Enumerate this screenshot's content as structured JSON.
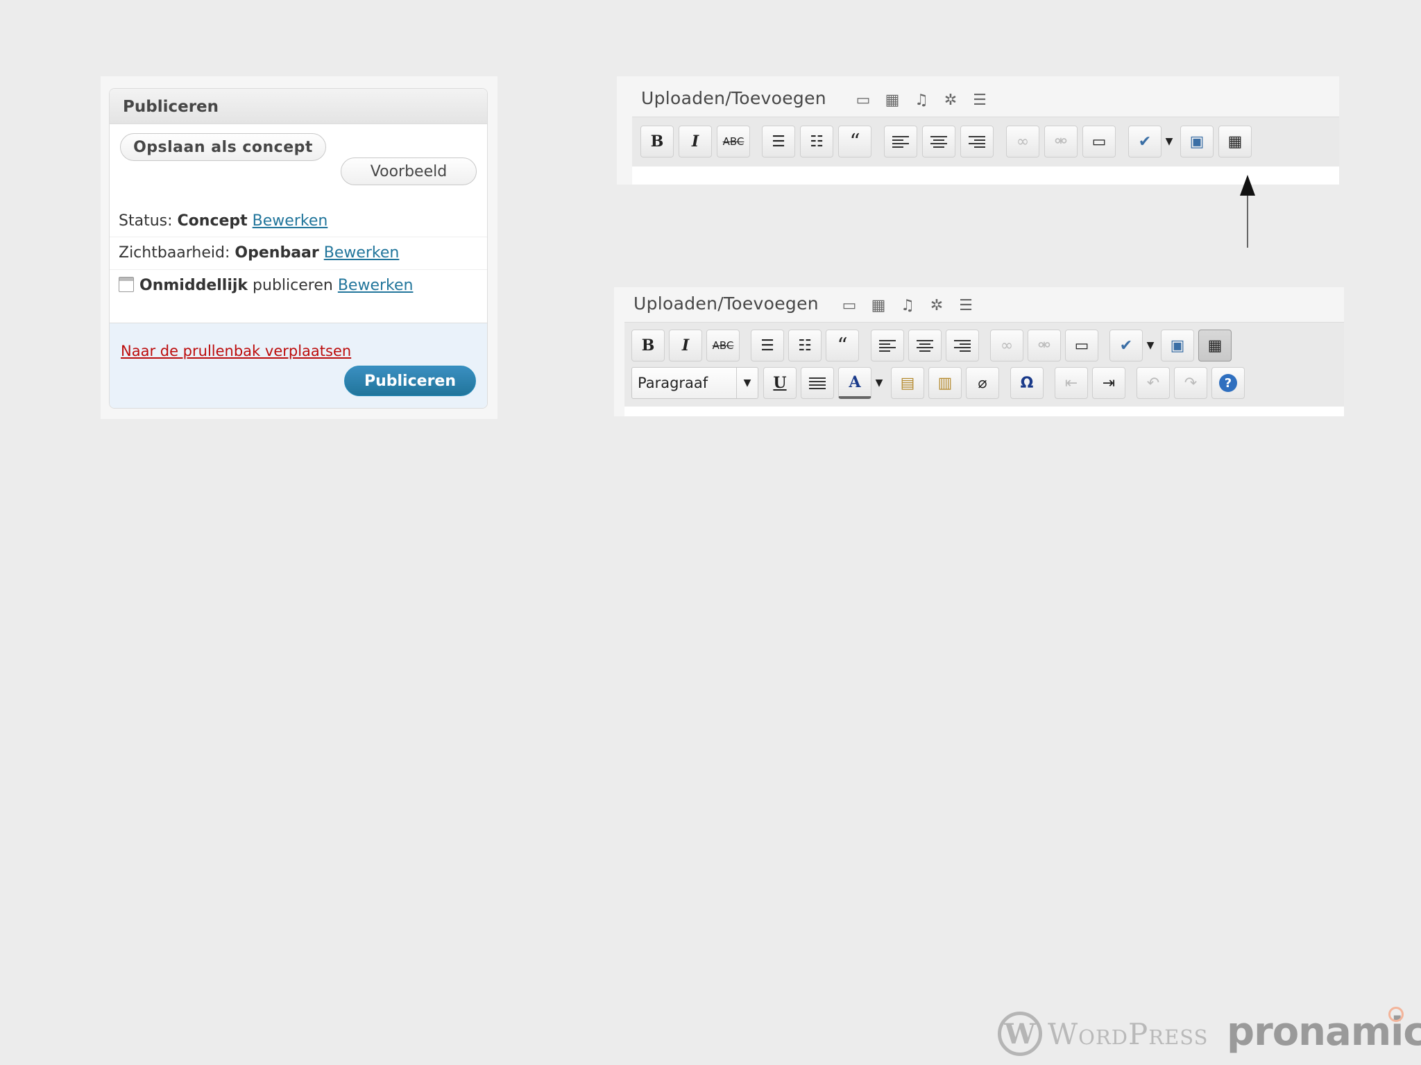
{
  "publish": {
    "title": "Publiceren",
    "save_draft_label": "Opslaan als concept",
    "preview_label": "Voorbeeld",
    "status_label": "Status:",
    "status_value": "Concept",
    "visibility_label": "Zichtbaarheid:",
    "visibility_value": "Openbaar",
    "schedule_value": "Onmiddellijk",
    "schedule_suffix": "publiceren",
    "edit_link": "Bewerken",
    "trash_label": "Naar de prullenbak verplaatsen",
    "publish_label": "Publiceren"
  },
  "editor_top": {
    "upload_label": "Uploaden/Toevoegen",
    "media_icons": [
      "image-icon",
      "gallery-icon",
      "audio-icon",
      "media-icon",
      "menu-icon"
    ],
    "row1": [
      {
        "name": "bold-button",
        "glyph": "B"
      },
      {
        "name": "italic-button",
        "glyph": "I"
      },
      {
        "name": "strikethrough-button",
        "glyph": "ABC"
      },
      {
        "name": "bullet-list-button",
        "glyph": "ul"
      },
      {
        "name": "numbered-list-button",
        "glyph": "ol"
      },
      {
        "name": "blockquote-button",
        "glyph": "“"
      },
      {
        "name": "align-left-button",
        "glyph": "al"
      },
      {
        "name": "align-center-button",
        "glyph": "ac"
      },
      {
        "name": "align-right-button",
        "glyph": "ar"
      },
      {
        "name": "insert-link-button",
        "glyph": "∞"
      },
      {
        "name": "unlink-button",
        "glyph": "⚮"
      },
      {
        "name": "more-tag-button",
        "glyph": "▭"
      },
      {
        "name": "spellcheck-button",
        "glyph": "✔"
      },
      {
        "name": "fullscreen-button",
        "glyph": "▣"
      },
      {
        "name": "kitchen-sink-button",
        "glyph": "▦"
      }
    ]
  },
  "editor_bottom": {
    "upload_label": "Uploaden/Toevoegen",
    "format_select": "Paragraaf",
    "row2": [
      {
        "name": "underline-button",
        "glyph": "U"
      },
      {
        "name": "justify-button",
        "glyph": "≣"
      },
      {
        "name": "text-color-button",
        "glyph": "A"
      },
      {
        "name": "paste-text-button",
        "glyph": "📋"
      },
      {
        "name": "paste-word-button",
        "glyph": "📋"
      },
      {
        "name": "clear-formatting-button",
        "glyph": "⌫"
      },
      {
        "name": "special-character-button",
        "glyph": "Ω"
      },
      {
        "name": "outdent-button",
        "glyph": "⇤"
      },
      {
        "name": "indent-button",
        "glyph": "⇥"
      },
      {
        "name": "undo-button",
        "glyph": "↶"
      },
      {
        "name": "redo-button",
        "glyph": "↷"
      },
      {
        "name": "help-button",
        "glyph": "?"
      }
    ]
  },
  "branding": {
    "wordpress": "WordPress",
    "pronamic": "pronamic"
  },
  "colors": {
    "link": "#21759b",
    "trash": "#bc0b0b",
    "publish_button": "#21759b"
  }
}
